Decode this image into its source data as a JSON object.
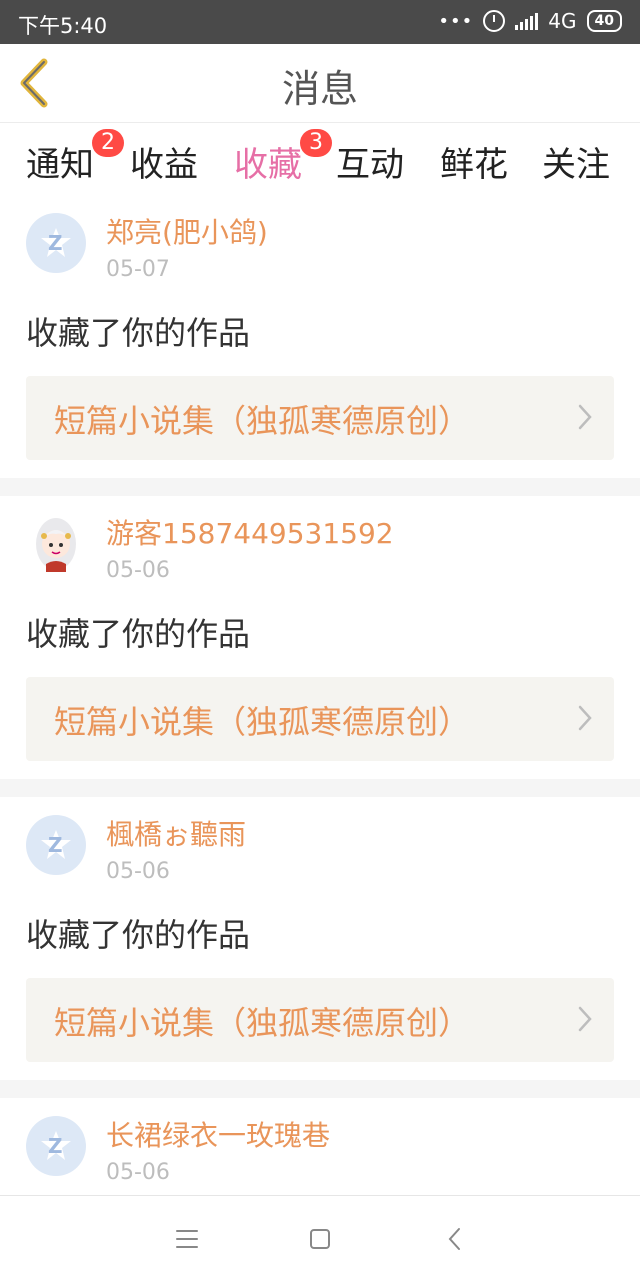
{
  "status_bar": {
    "time": "下午5:40",
    "dots": "•••",
    "network": "4G",
    "battery": "40"
  },
  "header": {
    "title": "消息"
  },
  "tabs": [
    {
      "label": "通知",
      "badge": "2"
    },
    {
      "label": "收益",
      "badge": ""
    },
    {
      "label": "收藏",
      "badge": "3"
    },
    {
      "label": "互动",
      "badge": ""
    },
    {
      "label": "鲜花",
      "badge": ""
    },
    {
      "label": "关注",
      "badge": ""
    }
  ],
  "items": [
    {
      "name": "郑亮(肥小鸽)",
      "date": "05-07",
      "action": "收藏了你的作品",
      "work": "短篇小说集（独孤寒德原创）",
      "avatar": "default"
    },
    {
      "name": "游客1587449531592",
      "date": "05-06",
      "action": "收藏了你的作品",
      "work": "短篇小说集（独孤寒德原创）",
      "avatar": "anime"
    },
    {
      "name": "楓橋ぉ聽雨",
      "date": "05-06",
      "action": "收藏了你的作品",
      "work": "短篇小说集（独孤寒德原创）",
      "avatar": "default"
    },
    {
      "name": "长裙绿衣一玫瑰巷",
      "date": "05-06",
      "action": "",
      "work": "",
      "avatar": "default"
    }
  ],
  "colors": {
    "accent": "#e66fa6",
    "name": "#e9955a",
    "badge": "#ff4a45",
    "status_bar": "#4a4a4a"
  },
  "icons": {
    "back": "back-arrow-icon",
    "menu": "menu-icon",
    "home": "home-square-icon",
    "nav_back": "nav-back-icon"
  }
}
